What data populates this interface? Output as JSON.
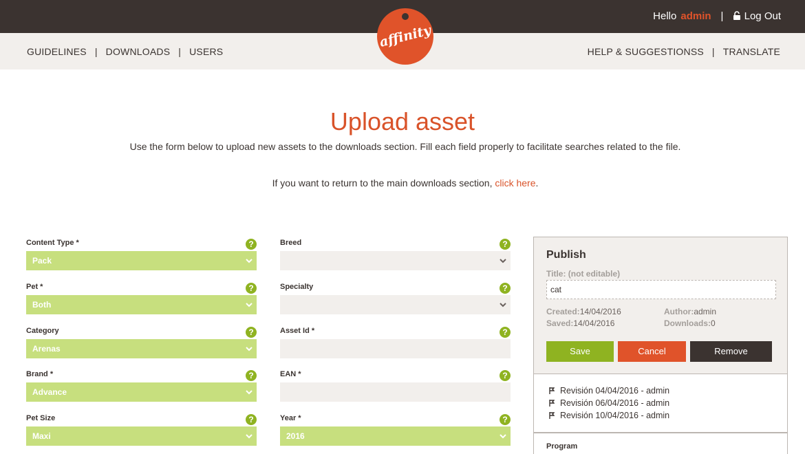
{
  "topbar": {
    "greeting": "Hello",
    "username": "admin",
    "separator": "|",
    "logout_label": "Log Out"
  },
  "nav": {
    "left": [
      "GUIDELINES",
      "DOWNLOADS",
      "USERS"
    ],
    "right": [
      "HELP & SUGGESTIONSS",
      "TRANSLATE"
    ],
    "separator": "|"
  },
  "logo": {
    "text": "affinity"
  },
  "page": {
    "title": "Upload asset",
    "subtitle": "Use the form below to upload new assets to the downloads section. Fill each field properly to facilitate searches related to the file.",
    "return_prefix": "If you want to return to the main downloads section, ",
    "return_link": "click here",
    "return_suffix": "."
  },
  "form": {
    "left": [
      {
        "label": "Content Type *",
        "value": "Pack",
        "kind": "select",
        "filled": true
      },
      {
        "label": "Pet *",
        "value": "Both",
        "kind": "select",
        "filled": true
      },
      {
        "label": "Category",
        "value": "Arenas",
        "kind": "select",
        "filled": true
      },
      {
        "label": "Brand *",
        "value": "Advance",
        "kind": "select",
        "filled": true
      },
      {
        "label": "Pet Size",
        "value": "Maxi",
        "kind": "select",
        "filled": true
      }
    ],
    "right": [
      {
        "label": "Breed",
        "value": "",
        "kind": "select",
        "filled": false
      },
      {
        "label": "Specialty",
        "value": "",
        "kind": "select",
        "filled": false
      },
      {
        "label": "Asset Id *",
        "value": "",
        "kind": "input",
        "filled": false
      },
      {
        "label": "EAN *",
        "value": "",
        "kind": "input",
        "filled": false
      },
      {
        "label": "Year *",
        "value": "2016",
        "kind": "select",
        "filled": true
      }
    ],
    "help_glyph": "?"
  },
  "publish": {
    "heading": "Publish",
    "title_label": "Title: (not editable)",
    "title_value": "cat",
    "created_label": "Created:",
    "created_value": "14/04/2016",
    "saved_label": "Saved:",
    "saved_value": "14/04/2016",
    "author_label": "Author:",
    "author_value": "admin",
    "downloads_label": "Downloads:",
    "downloads_value": "0",
    "save_label": "Save",
    "cancel_label": "Cancel",
    "remove_label": "Remove"
  },
  "revisions": [
    "Revisión 04/04/2016 - admin",
    "Revisión 06/04/2016 - admin",
    "Revisión 10/04/2016 - admin"
  ],
  "program": {
    "label": "Program"
  },
  "colors": {
    "brand_orange": "#e0532a",
    "dark": "#3b3330",
    "green": "#8fb321",
    "field_green": "#c7df7e",
    "field_grey": "#f2efec"
  }
}
